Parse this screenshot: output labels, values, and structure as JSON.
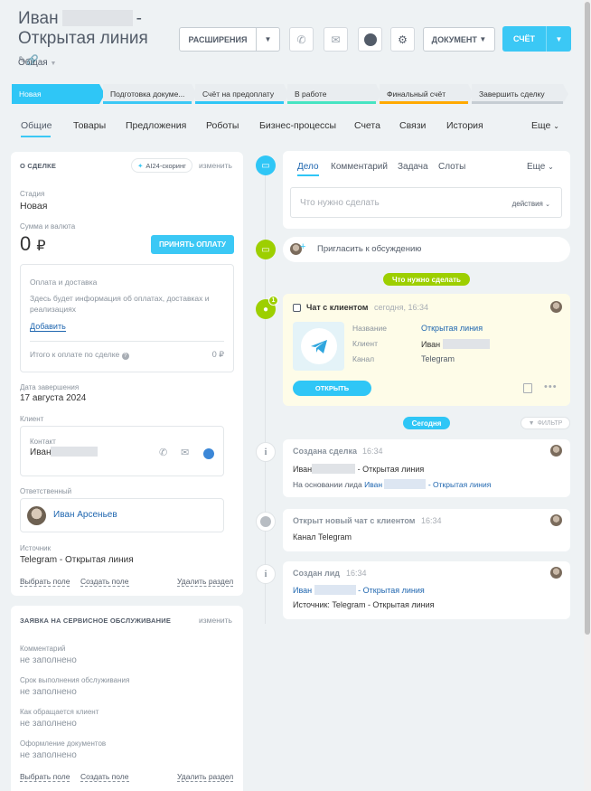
{
  "header": {
    "title_first": "Иван",
    "title_dash": "-",
    "title_second": "Открытая линия",
    "subtitle": "Общая",
    "extensions_label": "РАСШИРЕНИЯ",
    "document_label": "ДОКУМЕНТ",
    "invoice_label": "СЧЁТ"
  },
  "stages": [
    {
      "label": "Новая",
      "color": "#2fc6f6",
      "bar": "#2fc6f6"
    },
    {
      "label": "Подготовка докуме...",
      "color": "#e9edf0",
      "bar": "#3bc8f5"
    },
    {
      "label": "Счёт на предоплату",
      "color": "#e9edf0",
      "bar": "#2fc6f6"
    },
    {
      "label": "В работе",
      "color": "#e9edf0",
      "bar": "#47e4c2"
    },
    {
      "label": "Финальный счёт",
      "color": "#e9edf0",
      "bar": "#ffa900"
    },
    {
      "label": "Завершить сделку",
      "color": "#e9edf0",
      "bar": "#c6cdd3"
    }
  ],
  "tabs": [
    "Общие",
    "Товары",
    "Предложения",
    "Роботы",
    "Бизнес-процессы",
    "Счета",
    "Связи",
    "История",
    "Еще"
  ],
  "deal": {
    "section_title": "О СДЕЛКЕ",
    "scoring_label": "AI24-скоринг",
    "edit_label": "изменить",
    "stage_label": "Стадия",
    "stage_value": "Новая",
    "sum_label": "Сумма и валюта",
    "sum_value": "0",
    "currency": "₽",
    "accept_payment": "ПРИНЯТЬ ОПЛАТУ",
    "payment_title": "Оплата и доставка",
    "payment_text": "Здесь будет информация об оплатах, доставках и реализациях",
    "add_label": "Добавить",
    "total_label": "Итого к оплате по сделке",
    "total_value": "0 ₽",
    "close_date_label": "Дата завершения",
    "close_date_value": "17 августа 2024",
    "client_label": "Клиент",
    "contact_label": "Контакт",
    "contact_name": "Иван",
    "responsible_label": "Ответственный",
    "responsible_name": "Иван Арсеньев",
    "source_label": "Источник",
    "source_value": "Telegram - Открытая линия",
    "choose_field": "Выбрать поле",
    "create_field": "Создать поле",
    "delete_section": "Удалить раздел"
  },
  "service": {
    "section_title": "ЗАЯВКА НА СЕРВИСНОЕ ОБСЛУЖИВАНИЕ",
    "edit_label": "изменить",
    "fields": [
      {
        "label": "Комментарий",
        "value": "не заполнено"
      },
      {
        "label": "Срок выполнения обслуживания",
        "value": "не заполнено"
      },
      {
        "label": "Как обращается клиент",
        "value": "не заполнено"
      },
      {
        "label": "Оформление документов",
        "value": "не заполнено"
      }
    ],
    "choose_field": "Выбрать поле",
    "create_field": "Создать поле",
    "delete_section": "Удалить раздел"
  },
  "activity": {
    "tabs": [
      "Дело",
      "Комментарий",
      "Задача",
      "Слоты"
    ],
    "more": "Еще",
    "placeholder": "Что нужно сделать",
    "actions": "действия",
    "invite": "Пригласить к обсуждению"
  },
  "todo_pill": "Что нужно сделать",
  "chat": {
    "badge": "1",
    "title": "Чат с клиентом",
    "time": "сегодня, 16:34",
    "name_label": "Название",
    "name_value": "Открытая линия",
    "client_label": "Клиент",
    "client_value": "Иван",
    "channel_label": "Канал",
    "channel_value": "Telegram",
    "open_label": "ОТКРЫТЬ"
  },
  "today_pill": "Сегодня",
  "filter_label": "ФИЛЬТР",
  "events": [
    {
      "title": "Создана сделка",
      "time": "16:34",
      "line1_a": "Иван",
      "line1_b": "- Открытая линия",
      "line2_prefix": "На основании лида",
      "line2_link_a": "Иван",
      "line2_link_b": "- Открытая линия"
    },
    {
      "title": "Открыт новый чат с клиентом",
      "time": "16:34",
      "line1": "Канал Telegram"
    },
    {
      "title": "Создан лид",
      "time": "16:34",
      "link_a": "Иван",
      "link_b": "- Открытая линия",
      "line2": "Источник: Telegram - Открытая линия"
    }
  ]
}
